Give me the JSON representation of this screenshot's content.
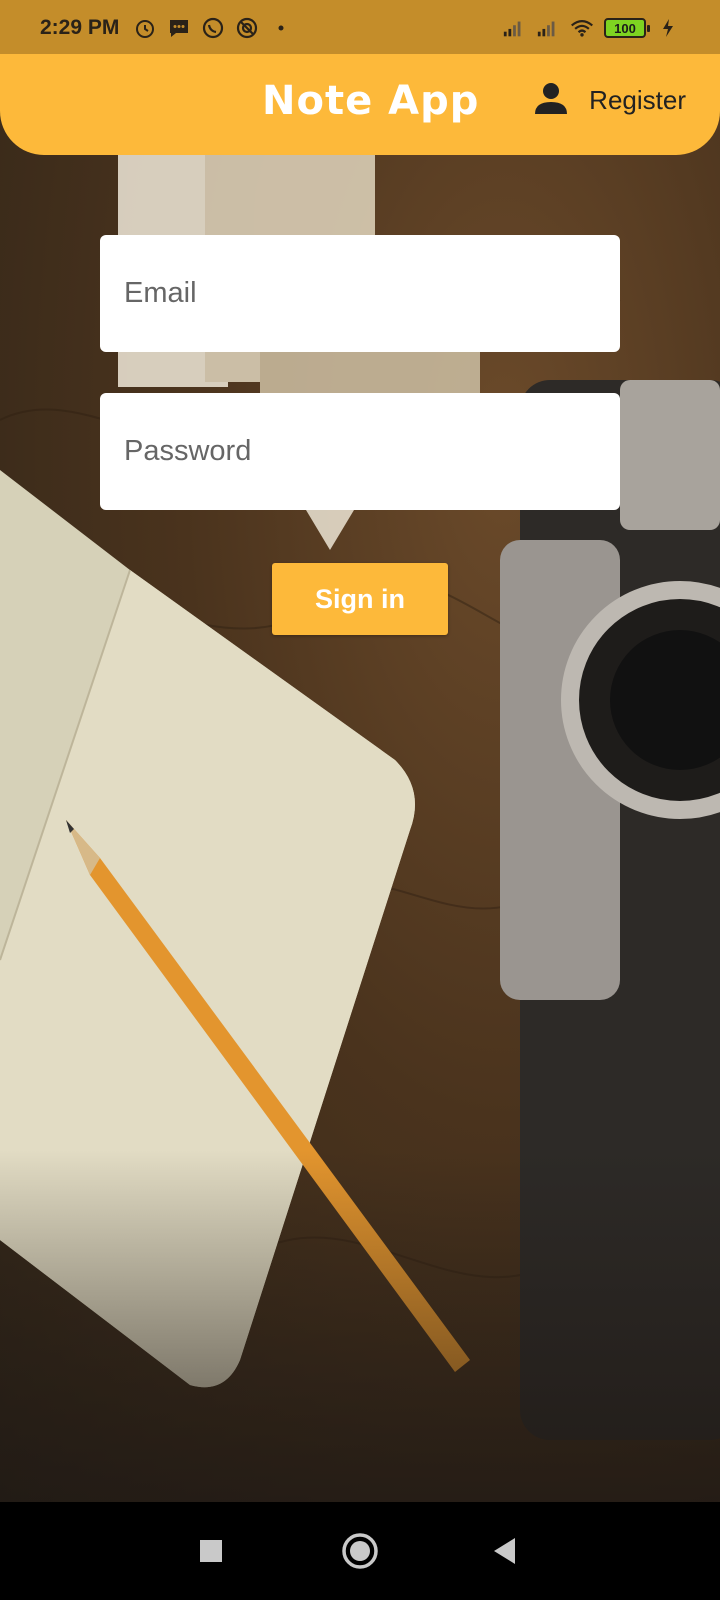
{
  "status_bar": {
    "time": "2:29 PM",
    "icons": [
      "alarm-icon",
      "message-icon",
      "whatsapp-icon",
      "data-saver-icon",
      "dot-icon"
    ],
    "battery_level": "100",
    "right_icons": [
      "signal-icon",
      "signal-icon",
      "wifi-icon",
      "battery-icon",
      "charging-icon"
    ]
  },
  "app_bar": {
    "title": "Note App",
    "register_label": "Register",
    "register_icon": "person-icon",
    "accent_color": "#fdb93a"
  },
  "form": {
    "email_placeholder": "Email",
    "password_placeholder": "Password",
    "signin_label": "Sign in"
  },
  "nav_bar": {
    "buttons": [
      "square-icon",
      "circle-icon",
      "back-triangle-icon"
    ]
  }
}
